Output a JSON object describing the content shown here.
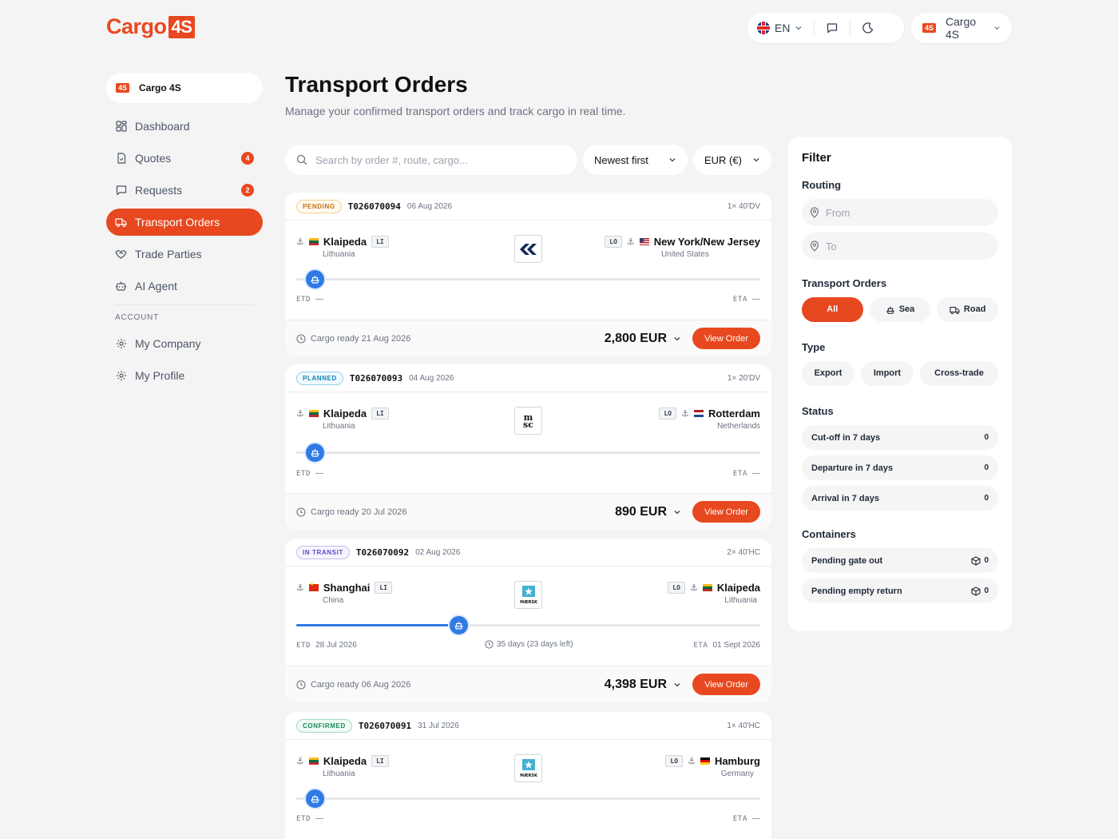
{
  "brand": {
    "name": "Cargo",
    "badge": "4S"
  },
  "header": {
    "language": "EN",
    "account": "Cargo 4S",
    "mini_logo": "4S"
  },
  "sidebar": {
    "org": {
      "logo": "4S",
      "name": "Cargo 4S"
    },
    "items": [
      {
        "label": "Dashboard",
        "icon": "dashboard-icon"
      },
      {
        "label": "Quotes",
        "icon": "document-icon",
        "badge": "4"
      },
      {
        "label": "Requests",
        "icon": "chat-icon",
        "badge": "2"
      },
      {
        "label": "Transport Orders",
        "icon": "truck-icon",
        "active": true
      },
      {
        "label": "Trade Parties",
        "icon": "handshake-icon"
      },
      {
        "label": "AI Agent",
        "icon": "robot-icon"
      }
    ],
    "account_section": "ACCOUNT",
    "account_items": [
      {
        "label": "My Company",
        "icon": "gear-icon"
      },
      {
        "label": "My Profile",
        "icon": "gear-icon"
      }
    ]
  },
  "main": {
    "title": "Transport Orders",
    "subtitle": "Manage your confirmed transport orders and track cargo in real time.",
    "search_placeholder": "Search by order #, route, cargo...",
    "sort": "Newest first",
    "currency": "EUR (€)"
  },
  "orders": [
    {
      "status": "PENDING",
      "number": "T026070094",
      "date": "06 Aug 2026",
      "containers": "1× 40'DV",
      "from": {
        "city": "Klaipeda",
        "country": "Lithuania",
        "code": "LI"
      },
      "to": {
        "city": "New York/New Jersey",
        "country": "United States",
        "code": "LO"
      },
      "carrier": "hapag-lloyd-logo",
      "progress": 0.04,
      "etd": "ETD",
      "etd_value": "—",
      "eta": "ETA",
      "eta_value": "—",
      "cargo_ready": "Cargo ready 21 Aug 2026",
      "price": "2,800 EUR",
      "action": "View Order"
    },
    {
      "status": "PLANNED",
      "number": "T026070093",
      "date": "04 Aug 2026",
      "containers": "1× 20'DV",
      "from": {
        "city": "Klaipeda",
        "country": "Lithuania",
        "code": "LI"
      },
      "to": {
        "city": "Rotterdam",
        "country": "Netherlands",
        "code": "LO"
      },
      "carrier": "msc-logo",
      "progress": 0.04,
      "etd": "ETD",
      "etd_value": "—",
      "eta": "ETA",
      "eta_value": "—",
      "cargo_ready": "Cargo ready 20 Jul 2026",
      "price": "890 EUR",
      "action": "View Order"
    },
    {
      "status": "IN TRANSIT",
      "number": "T026070092",
      "date": "02 Aug 2026",
      "containers": "2× 40'HC",
      "from": {
        "city": "Shanghai",
        "country": "China",
        "code": "LI"
      },
      "to": {
        "city": "Klaipeda",
        "country": "Lithuania",
        "code": "LO"
      },
      "carrier": "maersk-logo",
      "progress": 0.35,
      "etd": "ETD",
      "etd_value": "28 Jul 2026",
      "eta": "ETA",
      "eta_value": "01 Sept 2026",
      "duration": "35 days (23 days left)",
      "cargo_ready": "Cargo ready 06 Aug 2026",
      "price": "4,398 EUR",
      "action": "View Order"
    },
    {
      "status": "CONFIRMED",
      "number": "T026070091",
      "date": "31 Jul 2026",
      "containers": "1× 40'HC",
      "from": {
        "city": "Klaipeda",
        "country": "Lithuania",
        "code": "LI"
      },
      "to": {
        "city": "Hamburg",
        "country": "Germany",
        "code": "LO"
      },
      "carrier": "maersk-logo",
      "progress": 0.04,
      "etd": "ETD",
      "etd_value": "—",
      "eta": "ETA",
      "eta_value": "—"
    }
  ],
  "filter": {
    "title": "Filter",
    "routing_label": "Routing",
    "from_placeholder": "From",
    "to_placeholder": "To",
    "orders_label": "Transport Orders",
    "order_modes": [
      "All",
      "Sea",
      "Road"
    ],
    "type_label": "Type",
    "types": [
      "Export",
      "Import",
      "Cross-trade"
    ],
    "status_label": "Status",
    "statuses": [
      {
        "label": "Cut-off in 7 days",
        "count": "0"
      },
      {
        "label": "Departure in 7 days",
        "count": "0"
      },
      {
        "label": "Arrival in 7 days",
        "count": "0"
      }
    ],
    "containers_label": "Containers",
    "containers": [
      {
        "label": "Pending gate out",
        "count": "0"
      },
      {
        "label": "Pending empty return",
        "count": "0"
      }
    ]
  },
  "colors": {
    "accent": "#e8481f",
    "progress": "#2f7ae5"
  }
}
